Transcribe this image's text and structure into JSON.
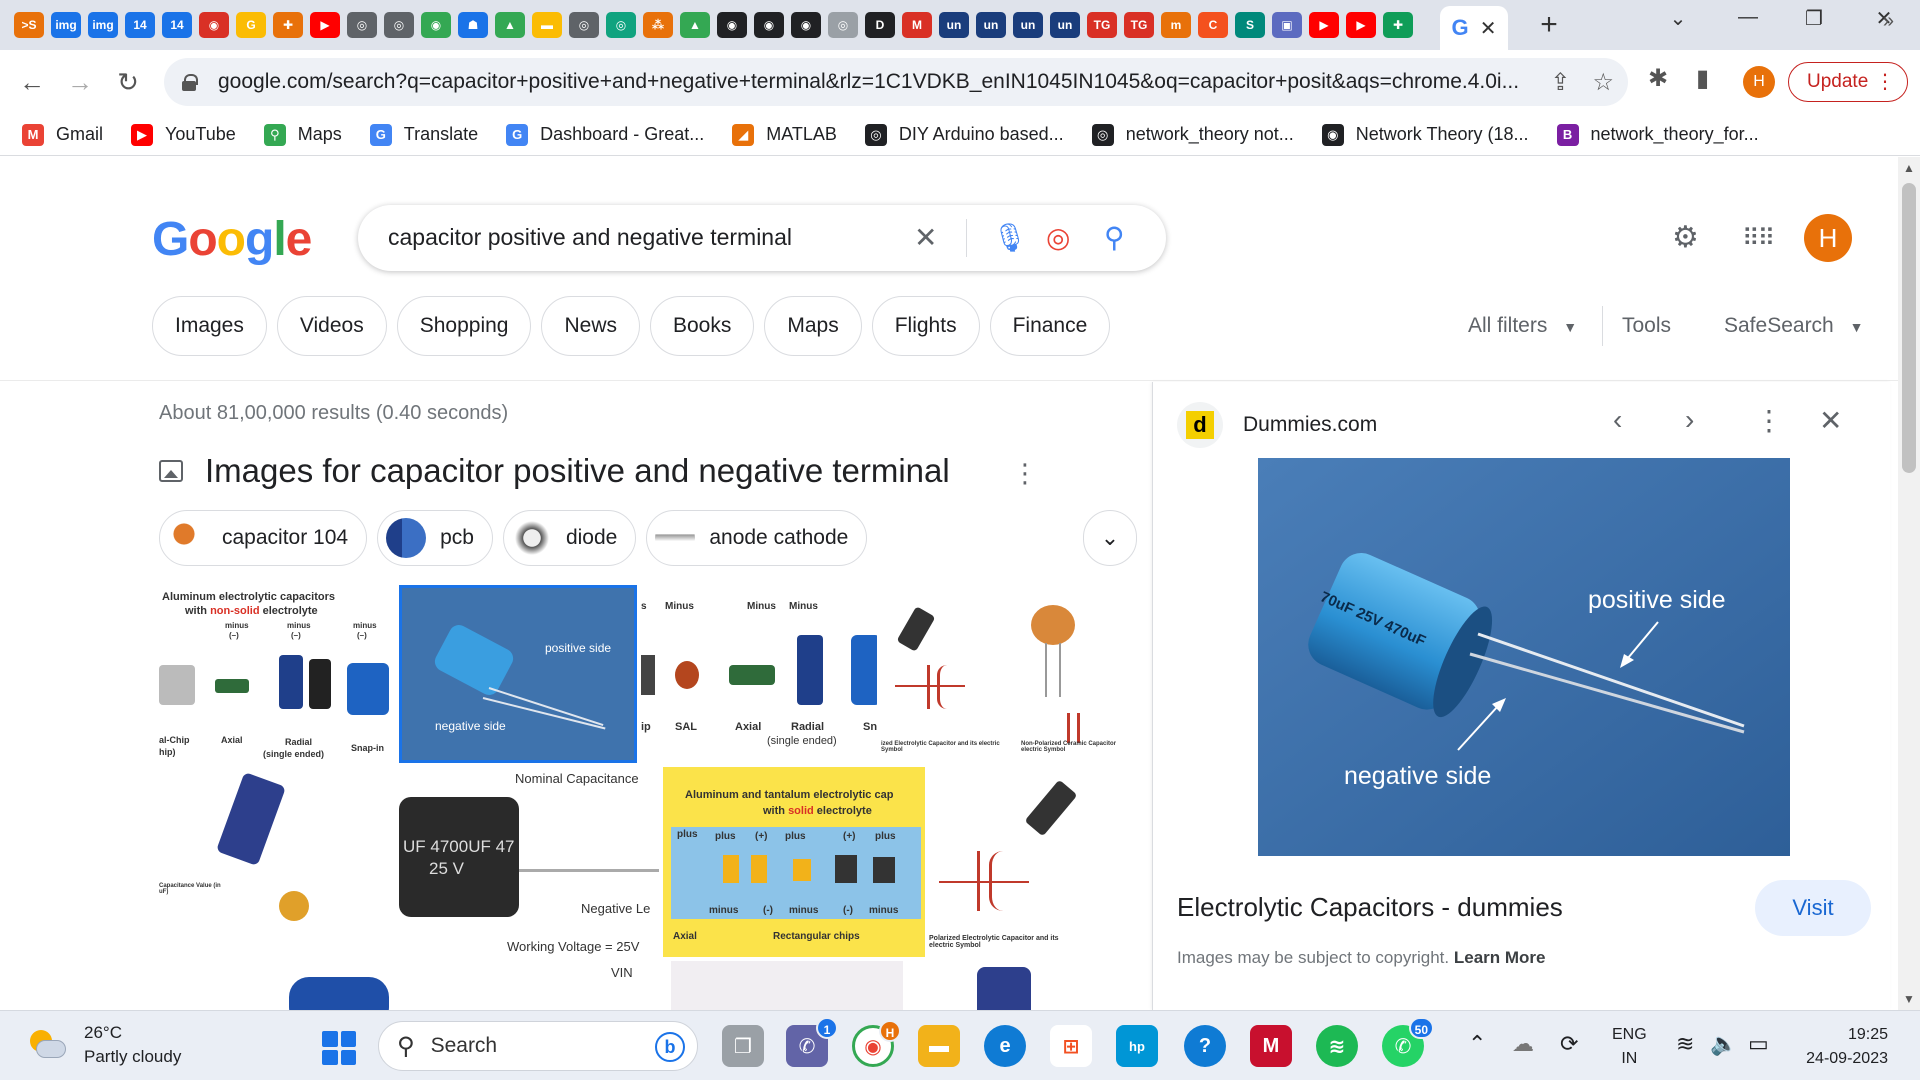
{
  "browser": {
    "tab_favicons": [
      {
        "icon": ">S",
        "color": "#e8710a"
      },
      {
        "icon": "img",
        "color": "#1a73e8"
      },
      {
        "icon": "img",
        "color": "#1a73e8"
      },
      {
        "icon": "14",
        "color": "#1a73e8"
      },
      {
        "icon": "14",
        "color": "#1a73e8"
      },
      {
        "icon": "◉",
        "color": "#d93025"
      },
      {
        "icon": "G",
        "color": "#fbbc04"
      },
      {
        "icon": "✚",
        "color": "#e8710a"
      },
      {
        "icon": "▶",
        "color": "#ff0000"
      },
      {
        "icon": "◎",
        "color": "#5f6368"
      },
      {
        "icon": "◎",
        "color": "#5f6368"
      },
      {
        "icon": "◉",
        "color": "#34a853"
      },
      {
        "icon": "☗",
        "color": "#1a73e8"
      },
      {
        "icon": "▲",
        "color": "#34a853"
      },
      {
        "icon": "▬",
        "color": "#fbbc04"
      },
      {
        "icon": "◎",
        "color": "#5f6368"
      },
      {
        "icon": "◎",
        "color": "#10a37f"
      },
      {
        "icon": "⁂",
        "color": "#e8710a"
      },
      {
        "icon": "▲",
        "color": "#34a853"
      },
      {
        "icon": "◉",
        "color": "#202124"
      },
      {
        "icon": "◉",
        "color": "#202124"
      },
      {
        "icon": "◉",
        "color": "#202124"
      },
      {
        "icon": "◎",
        "color": "#9aa0a6"
      },
      {
        "icon": "D",
        "color": "#202124"
      },
      {
        "icon": "M",
        "color": "#d93025"
      },
      {
        "icon": "un",
        "color": "#1a3d7c"
      },
      {
        "icon": "un",
        "color": "#1a3d7c"
      },
      {
        "icon": "un",
        "color": "#1a3d7c"
      },
      {
        "icon": "un",
        "color": "#1a3d7c"
      },
      {
        "icon": "TG",
        "color": "#d93025"
      },
      {
        "icon": "TG",
        "color": "#d93025"
      },
      {
        "icon": "m",
        "color": "#e8710a"
      },
      {
        "icon": "C",
        "color": "#f4511e"
      },
      {
        "icon": "S",
        "color": "#00897b"
      },
      {
        "icon": "▣",
        "color": "#5c6bc0"
      },
      {
        "icon": "▶",
        "color": "#ff0000"
      },
      {
        "icon": "▶",
        "color": "#ff0000"
      },
      {
        "icon": "✚",
        "color": "#0f9d58"
      }
    ],
    "active_tab_icon": "G",
    "url": "google.com/search?q=capacitor+positive+and+negative+terminal&rlz=1C1VDKB_enIN1045IN1045&oq=capacitor+posit&aqs=chrome.4.0i...",
    "update_label": "Update",
    "profile_initial": "H",
    "bookmarks": [
      {
        "label": "Gmail",
        "icon": "M",
        "color": "#ea4335"
      },
      {
        "label": "YouTube",
        "icon": "▶",
        "color": "#ff0000"
      },
      {
        "label": "Maps",
        "icon": "⚲",
        "color": "#34a853"
      },
      {
        "label": "Translate",
        "icon": "G",
        "color": "#4285f4"
      },
      {
        "label": "Dashboard - Great...",
        "icon": "G",
        "color": "#4285f4"
      },
      {
        "label": "MATLAB",
        "icon": "◢",
        "color": "#e8710a"
      },
      {
        "label": "DIY Arduino based...",
        "icon": "◎",
        "color": "#202124"
      },
      {
        "label": "network_theory not...",
        "icon": "◎",
        "color": "#202124"
      },
      {
        "label": "Network Theory (18...",
        "icon": "◉",
        "color": "#202124"
      },
      {
        "label": "network_theory_for...",
        "icon": "B",
        "color": "#7b1fa2"
      }
    ]
  },
  "google": {
    "logo": [
      "G",
      "o",
      "o",
      "g",
      "l",
      "e"
    ],
    "logo_colors": [
      "#4285f4",
      "#ea4335",
      "#fbbc05",
      "#4285f4",
      "#34a853",
      "#ea4335"
    ],
    "query": "capacitor positive and negative terminal",
    "profile_initial": "H",
    "filters": [
      "Images",
      "Videos",
      "Shopping",
      "News",
      "Books",
      "Maps",
      "Flights",
      "Finance"
    ],
    "all_filters_label": "All filters",
    "tools_label": "Tools",
    "safesearch_label": "SafeSearch",
    "stats": "About 81,00,000 results (0.40 seconds)",
    "images_heading": "Images for capacitor positive and negative terminal",
    "related_chips": [
      "capacitor 104",
      "pcb",
      "diode",
      "anode cathode"
    ]
  },
  "grid_labels": {
    "t1_title": "Aluminum electrolytic capacitors",
    "t1_sub_a": "with ",
    "t1_sub_b": "non-solid",
    "t1_sub_c": " electrolyte",
    "t1_minus": "minus",
    "t1_minus_sign": "(–)",
    "t1_chip": "al-Chip",
    "t1_chip2": "hip)",
    "t1_axial": "Axial",
    "t1_radial": "Radial",
    "t1_single": "(single ended)",
    "t1_snap": "Snap-in",
    "t2_pos": "positive side",
    "t2_neg": "negative side",
    "t3_s": "s",
    "t3_minus": "Minus",
    "t3_ip": "ip",
    "t3_sal": "SAL",
    "t3_axial": "Axial",
    "t3_radial": "Radial",
    "t3_single": "(single ended)",
    "t3_sn": "Sn",
    "t4_cap": "ized Electrolytic Capacitor and its electric Symbol",
    "t5_cap": "Non-Polarized Ceramic Capacitor electric Symbol",
    "t6_cap": "Capacitance Value (in uF)",
    "t7_nominal": "Nominal Capacitance",
    "t7_cap": "UF 4700UF 47",
    "t7_v": "25 V",
    "t7_neg": "Negative Le",
    "t7_work": "Working Voltage = 25V",
    "t8_title": "Aluminum and tantalum electrolytic cap",
    "t8_sub_a": "with ",
    "t8_sub_b": "solid",
    "t8_sub_c": " electrolyte",
    "t8_plus": "plus",
    "t8_plus_sign": "(+)",
    "t8_minus": "minus",
    "t8_minus_sign": "(-)",
    "t8_axial": "Axial",
    "t8_rect": "Rectangular chips",
    "t9_cap": "Polarized Electrolytic Capacitor and its electric Symbol",
    "t11_vin": "VIN"
  },
  "preview": {
    "site": "Dummies.com",
    "site_icon": "d",
    "cap_marking": "70uF 25V 470uF",
    "label_positive": "positive side",
    "label_negative": "negative side",
    "title": "Electrolytic Capacitors - dummies",
    "visit_label": "Visit",
    "copyright": "Images may be subject to copyright.",
    "learn_more": "Learn More"
  },
  "taskbar": {
    "temp": "26°C",
    "condition": "Partly cloudy",
    "search_label": "Search",
    "teams_badge": "1",
    "chrome_badge": "H",
    "whatsapp_badge": "50",
    "lang_1": "ENG",
    "lang_2": "IN",
    "time": "19:25",
    "date": "24-09-2023"
  }
}
